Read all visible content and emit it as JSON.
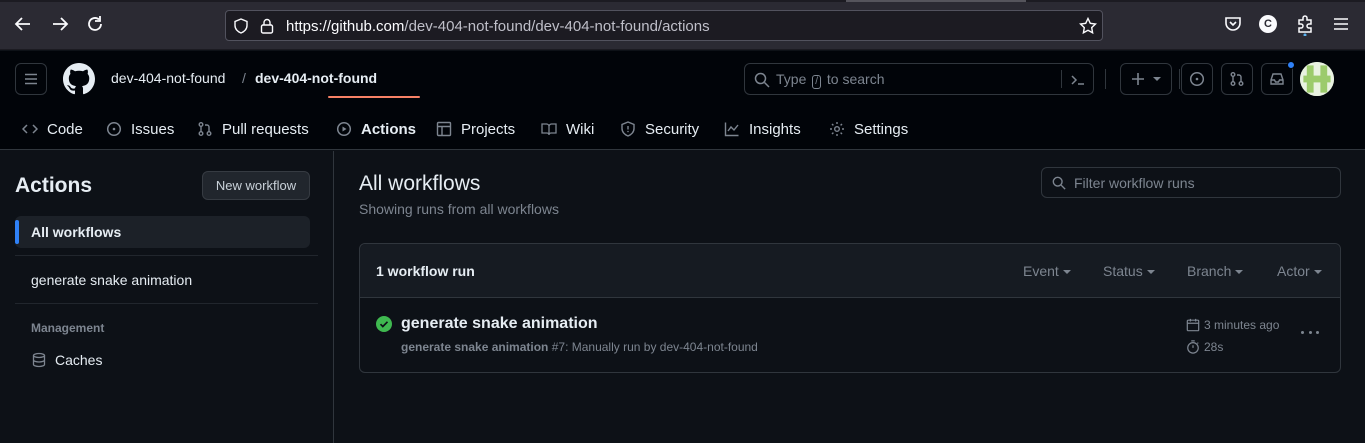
{
  "browser": {
    "url_host": "https://github.com",
    "url_path": "/dev-404-not-found/dev-404-not-found/actions",
    "account_initial": "C"
  },
  "header": {
    "owner": "dev-404-not-found",
    "separator": "/",
    "repo": "dev-404-not-found",
    "search_type": "Type",
    "search_key": "/",
    "search_rest": "to search"
  },
  "repo_nav": [
    {
      "label": "Code",
      "icon": "code-icon"
    },
    {
      "label": "Issues",
      "icon": "issue-icon"
    },
    {
      "label": "Pull requests",
      "icon": "pull-request-icon"
    },
    {
      "label": "Actions",
      "icon": "play-icon",
      "active": true
    },
    {
      "label": "Projects",
      "icon": "table-icon"
    },
    {
      "label": "Wiki",
      "icon": "book-icon"
    },
    {
      "label": "Security",
      "icon": "shield-icon"
    },
    {
      "label": "Insights",
      "icon": "graph-icon"
    },
    {
      "label": "Settings",
      "icon": "gear-icon"
    }
  ],
  "sidebar": {
    "title": "Actions",
    "new_workflow": "New workflow",
    "items": [
      {
        "label": "All workflows",
        "active": true
      },
      {
        "label": "generate snake animation"
      }
    ],
    "management_heading": "Management",
    "caches": "Caches"
  },
  "main": {
    "title": "All workflows",
    "subtitle": "Showing runs from all workflows",
    "filter_placeholder": "Filter workflow runs",
    "runs_count": "1 workflow run",
    "filters": [
      "Event",
      "Status",
      "Branch",
      "Actor"
    ],
    "run": {
      "title": "generate snake animation",
      "workflow": "generate snake animation",
      "detail": " #7: Manually run by dev-404-not-found",
      "time_ago": "3 minutes ago",
      "duration": "28s",
      "status": "success",
      "status_color": "#3fb950"
    }
  },
  "colors": {
    "accent_underline": "#f78166",
    "active_indicator": "#2f81f7",
    "notification_dot": "#2f81f7"
  }
}
